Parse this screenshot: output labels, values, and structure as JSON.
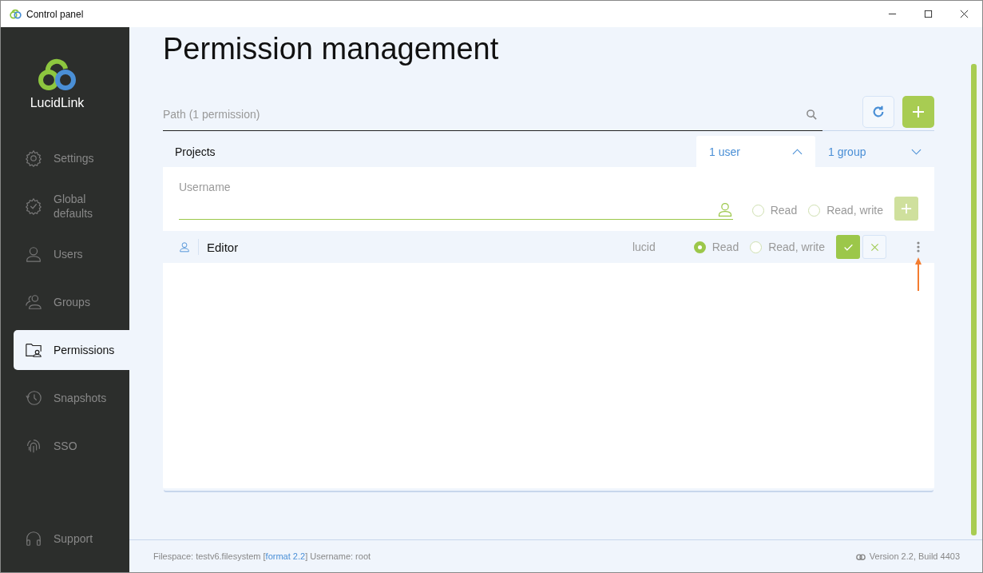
{
  "window": {
    "title": "Control panel"
  },
  "sidebar": {
    "brand": "LucidLink",
    "items": [
      {
        "label": "Settings",
        "selected": false
      },
      {
        "label": "Global defaults",
        "selected": false
      },
      {
        "label": "Users",
        "selected": false
      },
      {
        "label": "Groups",
        "selected": false
      },
      {
        "label": "Permissions",
        "selected": true
      },
      {
        "label": "Snapshots",
        "selected": false
      },
      {
        "label": "SSO",
        "selected": false
      }
    ],
    "support": "Support"
  },
  "page_title": "Permission management",
  "path_search": {
    "placeholder": "Path (1 permission)"
  },
  "folder": {
    "name": "Projects",
    "tabs": [
      {
        "label": "1 user",
        "selected": true,
        "expanded": true
      },
      {
        "label": "1 group",
        "selected": false,
        "expanded": false
      }
    ]
  },
  "new_entry": {
    "placeholder": "Username",
    "options": [
      {
        "label": "Read",
        "selected": false
      },
      {
        "label": "Read, write",
        "selected": false
      }
    ],
    "add_disabled": true
  },
  "entries": [
    {
      "name": "Editor",
      "owner": "lucid",
      "options": [
        {
          "label": "Read",
          "selected": true
        },
        {
          "label": "Read, write",
          "selected": false
        }
      ]
    }
  ],
  "status_bar": {
    "prefix": "Filespace: testv6.filesystem [",
    "link": "format 2.2",
    "suffix": "] Username: root",
    "version": "Version 2.2, Build 4403"
  }
}
